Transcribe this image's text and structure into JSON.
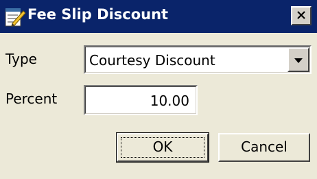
{
  "window": {
    "title": "Fee Slip Discount",
    "icon": "notepad-pencil-icon",
    "close_icon": "close-icon"
  },
  "form": {
    "type_label": "Type",
    "type_value": "Courtesy Discount",
    "percent_label": "Percent",
    "percent_value": "10.00"
  },
  "buttons": {
    "ok_label": "OK",
    "cancel_label": "Cancel"
  },
  "colors": {
    "titlebar": "#0a246a",
    "window_bg": "#ece9d8"
  }
}
